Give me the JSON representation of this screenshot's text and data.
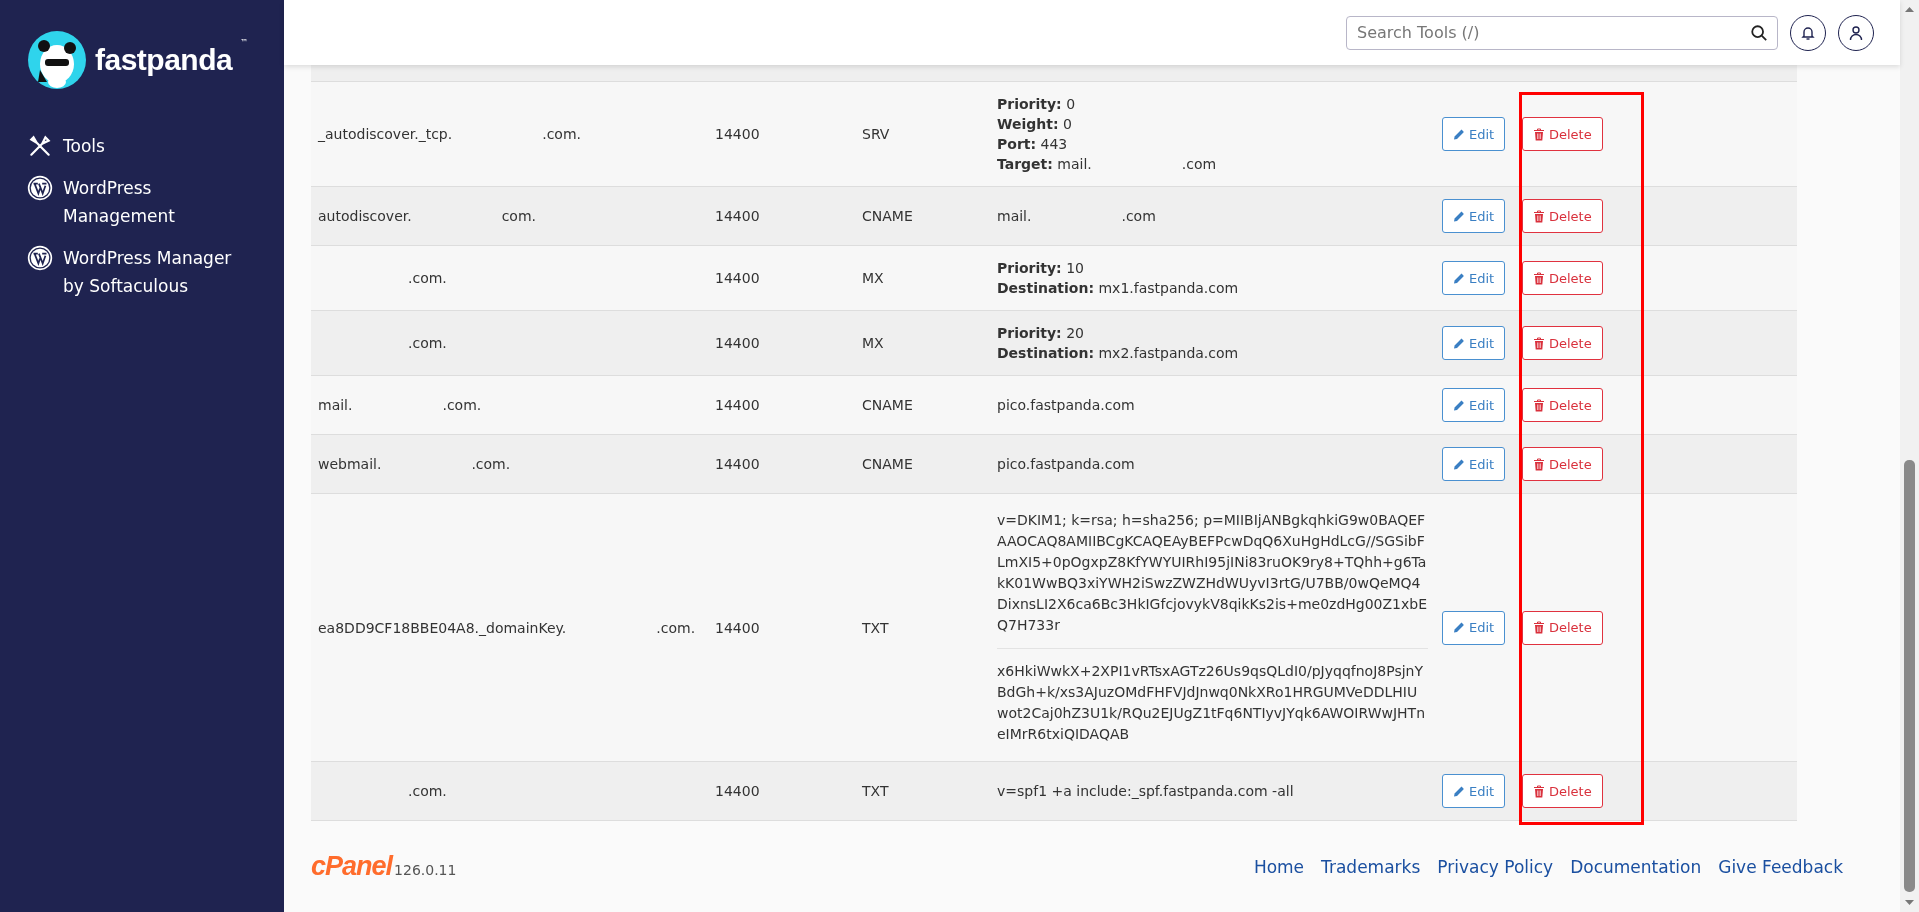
{
  "sidebar": {
    "brand": "fastpanda",
    "trademark": "™",
    "items": [
      {
        "kind": "tools",
        "label": "Tools"
      },
      {
        "kind": "wordpress",
        "label": "WordPress Management"
      },
      {
        "kind": "wordpress",
        "label": "WordPress Manager by Softaculous"
      }
    ]
  },
  "header": {
    "search": {
      "placeholder": "Search Tools (/)"
    }
  },
  "records": [
    {
      "name_start": "_autodiscover._tcp.",
      "name_end": ".com.",
      "ttl": "14400",
      "type": "SRV",
      "lines": [
        {
          "label": "Priority:",
          "text": "0"
        },
        {
          "label": "Weight:",
          "text": "0"
        },
        {
          "label": "Port:",
          "text": "443"
        },
        {
          "label": "Target:",
          "text": "mail.",
          "text_end": ".com"
        }
      ],
      "edit": "Edit",
      "delete": "Delete"
    },
    {
      "name_start": "autodiscover.",
      "name_end": "com.",
      "ttl": "14400",
      "type": "CNAME",
      "lines": [
        {
          "text": "mail.",
          "text_end": ".com"
        }
      ],
      "edit": "Edit",
      "delete": "Delete"
    },
    {
      "name_end": ".com.",
      "ttl": "14400",
      "type": "MX",
      "lines": [
        {
          "label": "Priority:",
          "text": "10"
        },
        {
          "label": "Destination:",
          "text": "mx1.fastpanda.com"
        }
      ],
      "edit": "Edit",
      "delete": "Delete"
    },
    {
      "name_end": ".com.",
      "ttl": "14400",
      "type": "MX",
      "lines": [
        {
          "label": "Priority:",
          "text": "20"
        },
        {
          "label": "Destination:",
          "text": "mx2.fastpanda.com"
        }
      ],
      "edit": "Edit",
      "delete": "Delete"
    },
    {
      "name_start": "mail.",
      "name_end": ".com.",
      "ttl": "14400",
      "type": "CNAME",
      "lines": [
        {
          "text": "pico.fastpanda.com"
        }
      ],
      "edit": "Edit",
      "delete": "Delete"
    },
    {
      "name_start": "webmail.",
      "name_end": ".com.",
      "ttl": "14400",
      "type": "CNAME",
      "lines": [
        {
          "text": "pico.fastpanda.com"
        }
      ],
      "edit": "Edit",
      "delete": "Delete"
    },
    {
      "name_start": "ea8DD9CF18BBE04A8._domainKey.",
      "name_end": ".com.",
      "ttl": "14400",
      "type": "TXT",
      "chunks": [
        "v=DKIM1; k=rsa; h=sha256; p=MIIBIjANBgkqhkiG9w0BAQEFAAOCAQ8AMIIBCgKCAQEAyBEFPcwDqQ6XuHgHdLcG//SGSibFLmXI5+0pOgxpZ8KfYWYUIRhI95jINi83ruOK9ry8+TQhh+g6TakK01WwBQ3xiYWH2iSwzZWZHdWUyvI3rtG/U7BB/0wQeMQ4DixnsLI2X6ca6Bc3HkIGfcjovykV8qikKs2is+me0zdHg00Z1xbEQ7H733r",
        "x6HkiWwkX+2XPI1vRTsxAGTz26Us9qsQLdI0/pJyqqfnoJ8PsjnYBdGh+k/xs3AJuzOMdFHFVJdJnwq0NkXRo1HRGUMVeDDLHIUwot2Caj0hZ3U1k/RQu2EJUgZ1tFq6NTIyvJYqk6AWOIRWwJHTneIMrR6txiQIDAQAB"
      ],
      "edit": "Edit",
      "delete": "Delete"
    },
    {
      "name_end": ".com.",
      "ttl": "14400",
      "type": "TXT",
      "lines": [
        {
          "text": "v=spf1 +a include:_spf.fastpanda.com -all"
        }
      ],
      "edit": "Edit",
      "delete": "Delete"
    }
  ],
  "footer": {
    "logo": "cPanel",
    "version": "126.0.11",
    "links": [
      "Home",
      "Trademarks",
      "Privacy Policy",
      "Documentation",
      "Give Feedback"
    ]
  }
}
